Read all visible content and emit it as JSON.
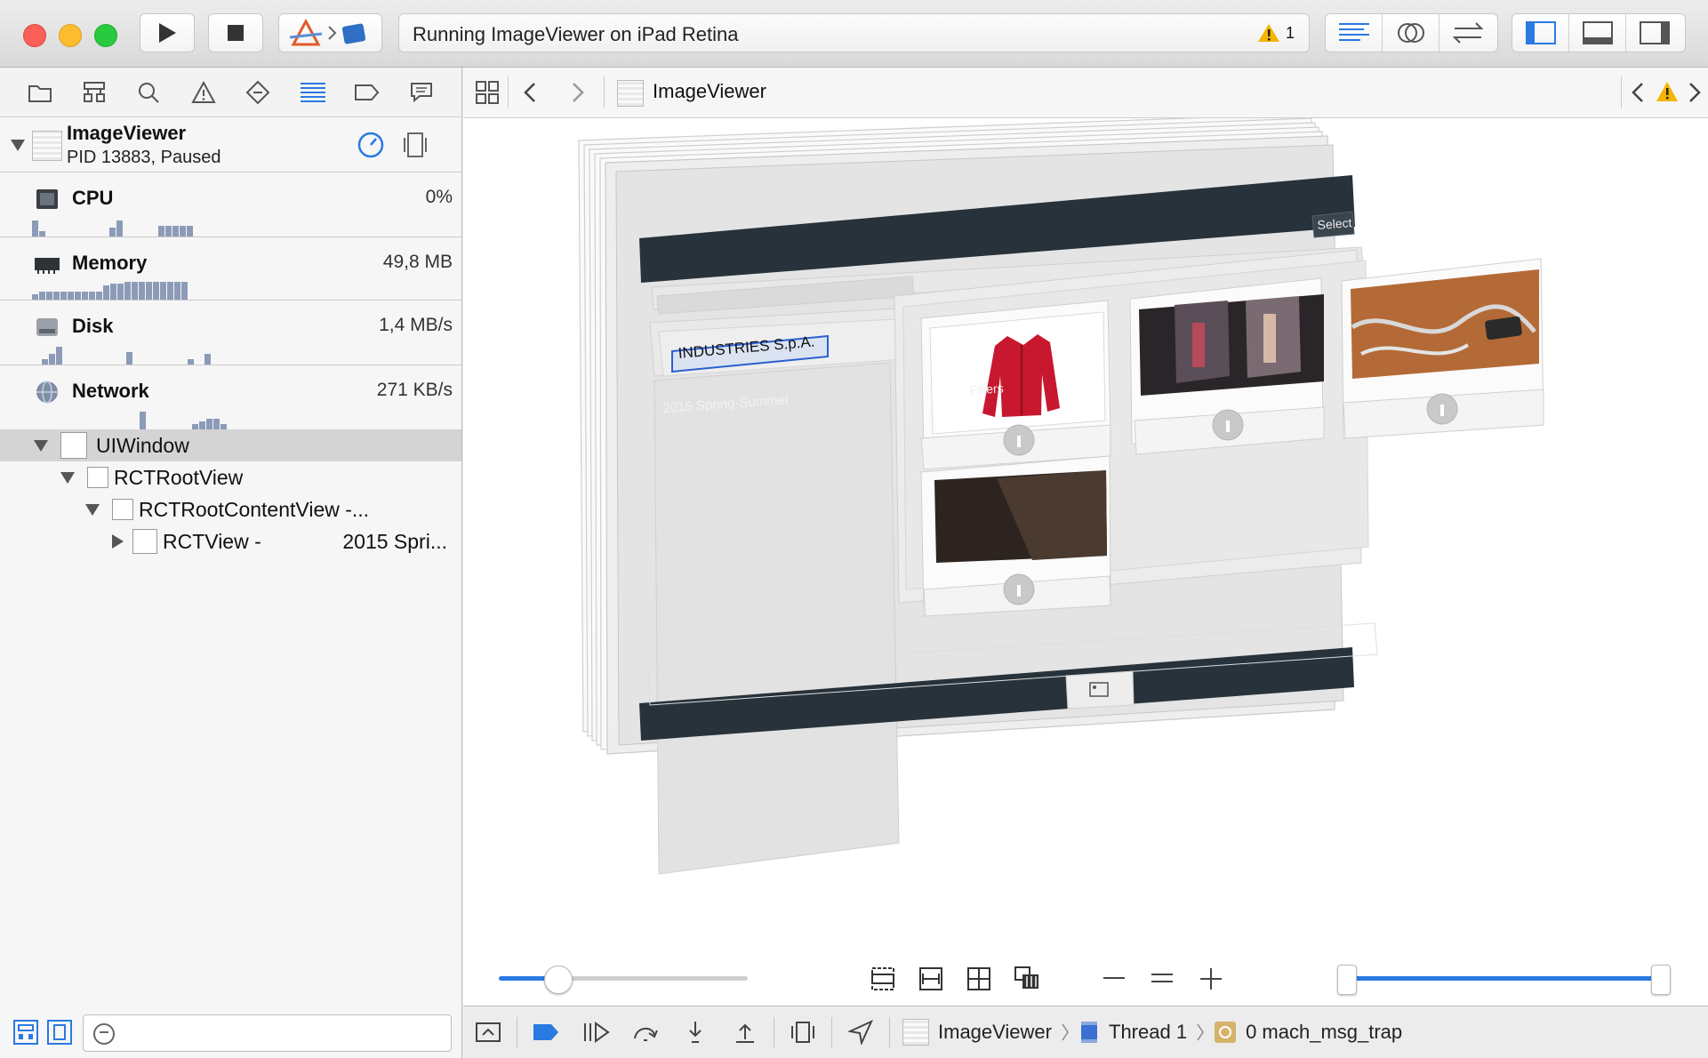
{
  "toolbar": {
    "run_label": "Run",
    "stop_label": "Stop",
    "activity_status": "Running ImageViewer on iPad Retina",
    "warning_count": "1"
  },
  "navigator": {
    "process": {
      "name": "ImageViewer",
      "pid_status": "PID 13883, Paused"
    },
    "gauges": [
      {
        "label": "CPU",
        "value": "0%"
      },
      {
        "label": "Memory",
        "value": "49,8 MB"
      },
      {
        "label": "Disk",
        "value": "1,4 MB/s"
      },
      {
        "label": "Network",
        "value": "271 KB/s"
      }
    ],
    "tree": [
      {
        "label": "UIWindow",
        "extra": ""
      },
      {
        "label": "RCTRootView",
        "extra": ""
      },
      {
        "label": "RCTRootContentView -...",
        "extra": ""
      },
      {
        "label": "RCTView -",
        "extra": "2015 Spri..."
      }
    ]
  },
  "jumpbar": {
    "title": "ImageViewer"
  },
  "canvas": {
    "back_title": "2015 Spring-Summer",
    "filters": "Filters",
    "select": "Select",
    "company": "INDUSTRIES S.p.A."
  },
  "debug": {
    "app": "ImageViewer",
    "thread": "Thread 1",
    "frame": "0 mach_msg_trap"
  },
  "colors": {
    "accent": "#2a7ae2",
    "dark_bar": "#27323a",
    "warning": "#f5b400"
  }
}
